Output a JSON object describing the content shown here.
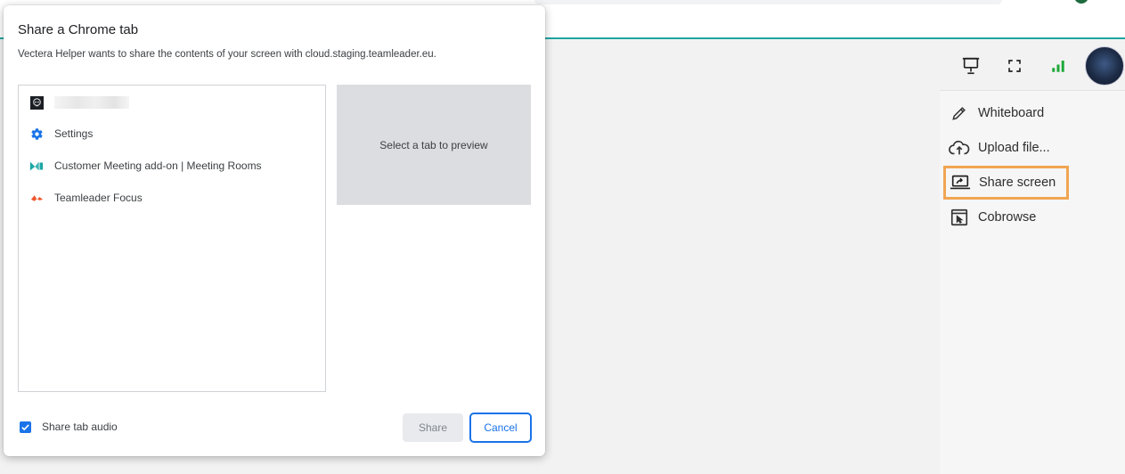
{
  "dialog": {
    "title": "Share a Chrome tab",
    "subtitle": "Vectera Helper wants to share the contents of your screen with cloud.staging.teamleader.eu.",
    "tabs": [
      {
        "label": "",
        "icon": "skull-favicon-icon"
      },
      {
        "label": "Settings",
        "icon": "gear-icon"
      },
      {
        "label": "Customer Meeting add-on | Meeting Rooms",
        "icon": "meeting-logo-icon"
      },
      {
        "label": "Teamleader Focus",
        "icon": "teamleader-logo-icon"
      }
    ],
    "preview_text": "Select a tab to preview",
    "audio_label": "Share tab audio",
    "audio_checked": true,
    "share_label": "Share",
    "cancel_label": "Cancel"
  },
  "toolbar": {
    "icons": [
      "presentation-icon",
      "fullscreen-icon",
      "signal-icon"
    ]
  },
  "menu": {
    "items": [
      {
        "label": "Whiteboard",
        "icon": "pencil-icon"
      },
      {
        "label": "Upload file...",
        "icon": "cloud-upload-icon"
      },
      {
        "label": "Share screen",
        "icon": "screen-share-icon",
        "highlighted": true
      },
      {
        "label": "Cobrowse",
        "icon": "cobrowse-icon"
      }
    ]
  },
  "colors": {
    "accent": "#1fa5a3",
    "highlight": "#f0a552",
    "chrome_blue": "#1a73e8",
    "signal_green": "#1fa83a"
  }
}
